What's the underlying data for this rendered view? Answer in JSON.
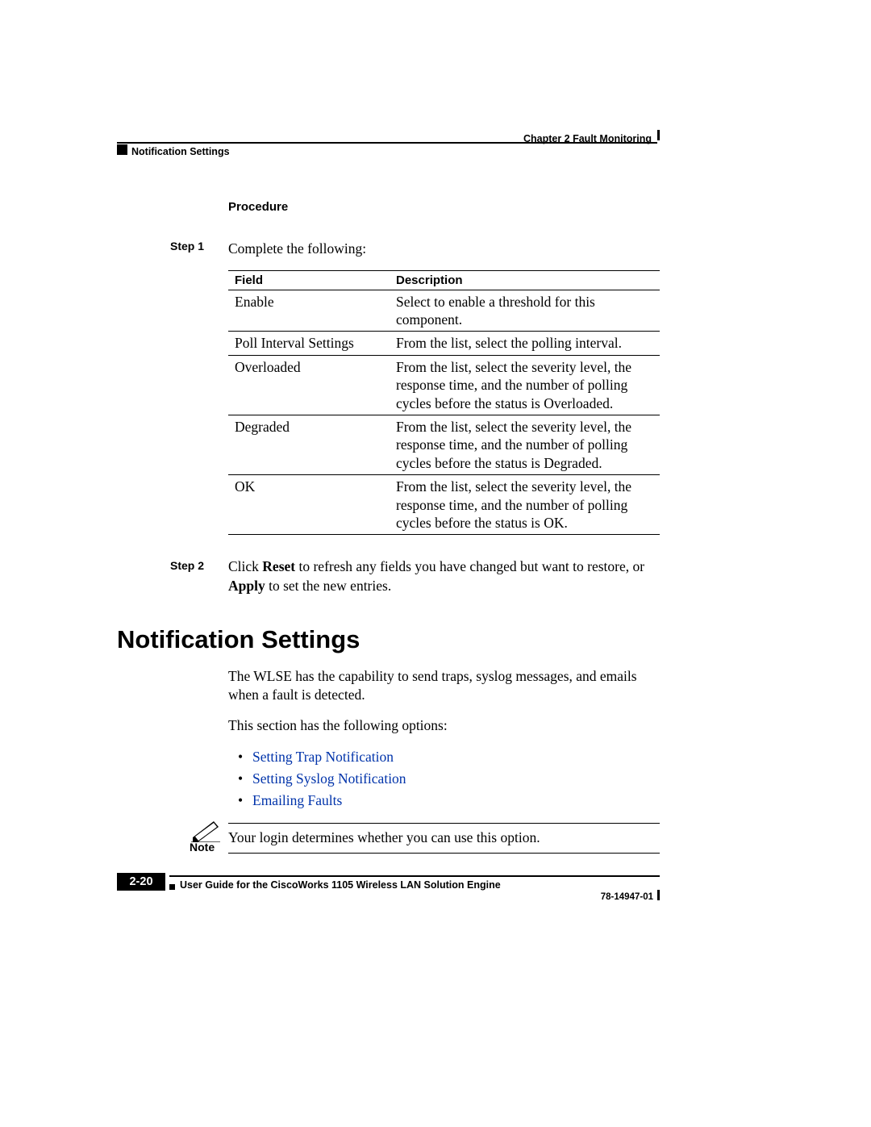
{
  "header": {
    "chapter_label": "Chapter 2      Fault Monitoring",
    "section_label": "Notification Settings"
  },
  "procedure": {
    "label": "Procedure",
    "step1": {
      "label": "Step 1",
      "text": "Complete the following:"
    },
    "table": {
      "col_field": "Field",
      "col_desc": "Description",
      "rows": [
        {
          "field": "Enable",
          "desc": "Select to enable a threshold for this component."
        },
        {
          "field": "Poll Interval Settings",
          "desc": "From the list, select the polling interval."
        },
        {
          "field": "Overloaded",
          "desc": "From the list, select the severity level, the response time, and the number of polling cycles before the status is Overloaded."
        },
        {
          "field": "Degraded",
          "desc": "From the list, select the severity level, the response time, and the number of polling cycles before the status is Degraded."
        },
        {
          "field": "OK",
          "desc": "From the list, select the severity level, the response time, and the number of polling cycles before the status is OK."
        }
      ]
    },
    "step2": {
      "label": "Step 2",
      "text_before": "Click ",
      "reset": "Reset",
      "text_mid": " to refresh any fields you have changed but want to restore, or ",
      "apply": "Apply",
      "text_after": " to set the new entries."
    }
  },
  "section": {
    "heading": "Notification Settings",
    "para1": "The WLSE has the capability to send traps, syslog messages, and emails when a fault is detected.",
    "para2": "This section has the following options:",
    "options": {
      "opt1": "Setting Trap Notification",
      "opt2": "Setting Syslog Notification",
      "opt3": "Emailing Faults"
    },
    "note": {
      "label": "Note",
      "text": "Your login determines whether you can use this option."
    }
  },
  "footer": {
    "guide_title": "User Guide for the CiscoWorks 1105 Wireless LAN Solution Engine",
    "page_number": "2-20",
    "doc_number": "78-14947-01"
  }
}
